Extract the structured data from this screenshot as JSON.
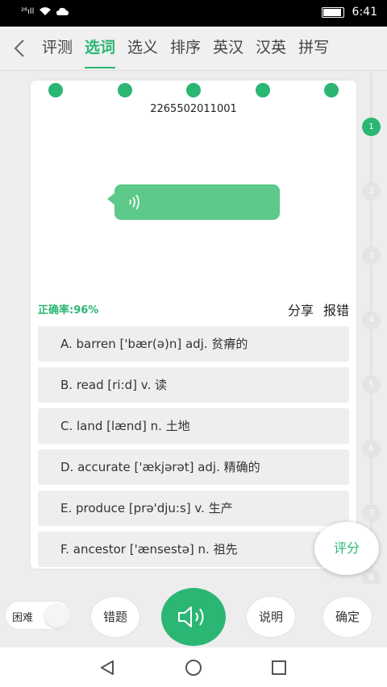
{
  "status_bar": {
    "signal_text": "²⁶ıll",
    "time": "6:41",
    "battery_level": 0.85
  },
  "header": {
    "tabs": [
      "评测",
      "选词",
      "选义",
      "排序",
      "英汉",
      "汉英",
      "拼写"
    ],
    "active_tab": "选词"
  },
  "card": {
    "code": "2265502011001",
    "accuracy": "正确率:96%",
    "share": "分享",
    "report": "报错",
    "options": [
      "A. barren ['bær(ə)n] adj. 贫瘠的",
      "B. read [ri:d] v. 读",
      "C. land [lænd] n. 土地",
      "D. accurate ['ækjərət] adj. 精确的",
      "E. produce [prə'dju:s] v. 生产",
      "F. ancestor ['ænsestə] n. 祖先"
    ]
  },
  "progress": {
    "nodes": [
      "1",
      "2",
      "3",
      "4",
      "5",
      "6",
      "7",
      "8"
    ],
    "current": "1"
  },
  "score_button": "评分",
  "bottom": {
    "difficulty_label": "困难",
    "wrong_label": "错题",
    "explain_label": "说明",
    "confirm_label": "确定"
  },
  "colors": {
    "accent": "#2bb673",
    "bubble": "#5dc98a"
  }
}
